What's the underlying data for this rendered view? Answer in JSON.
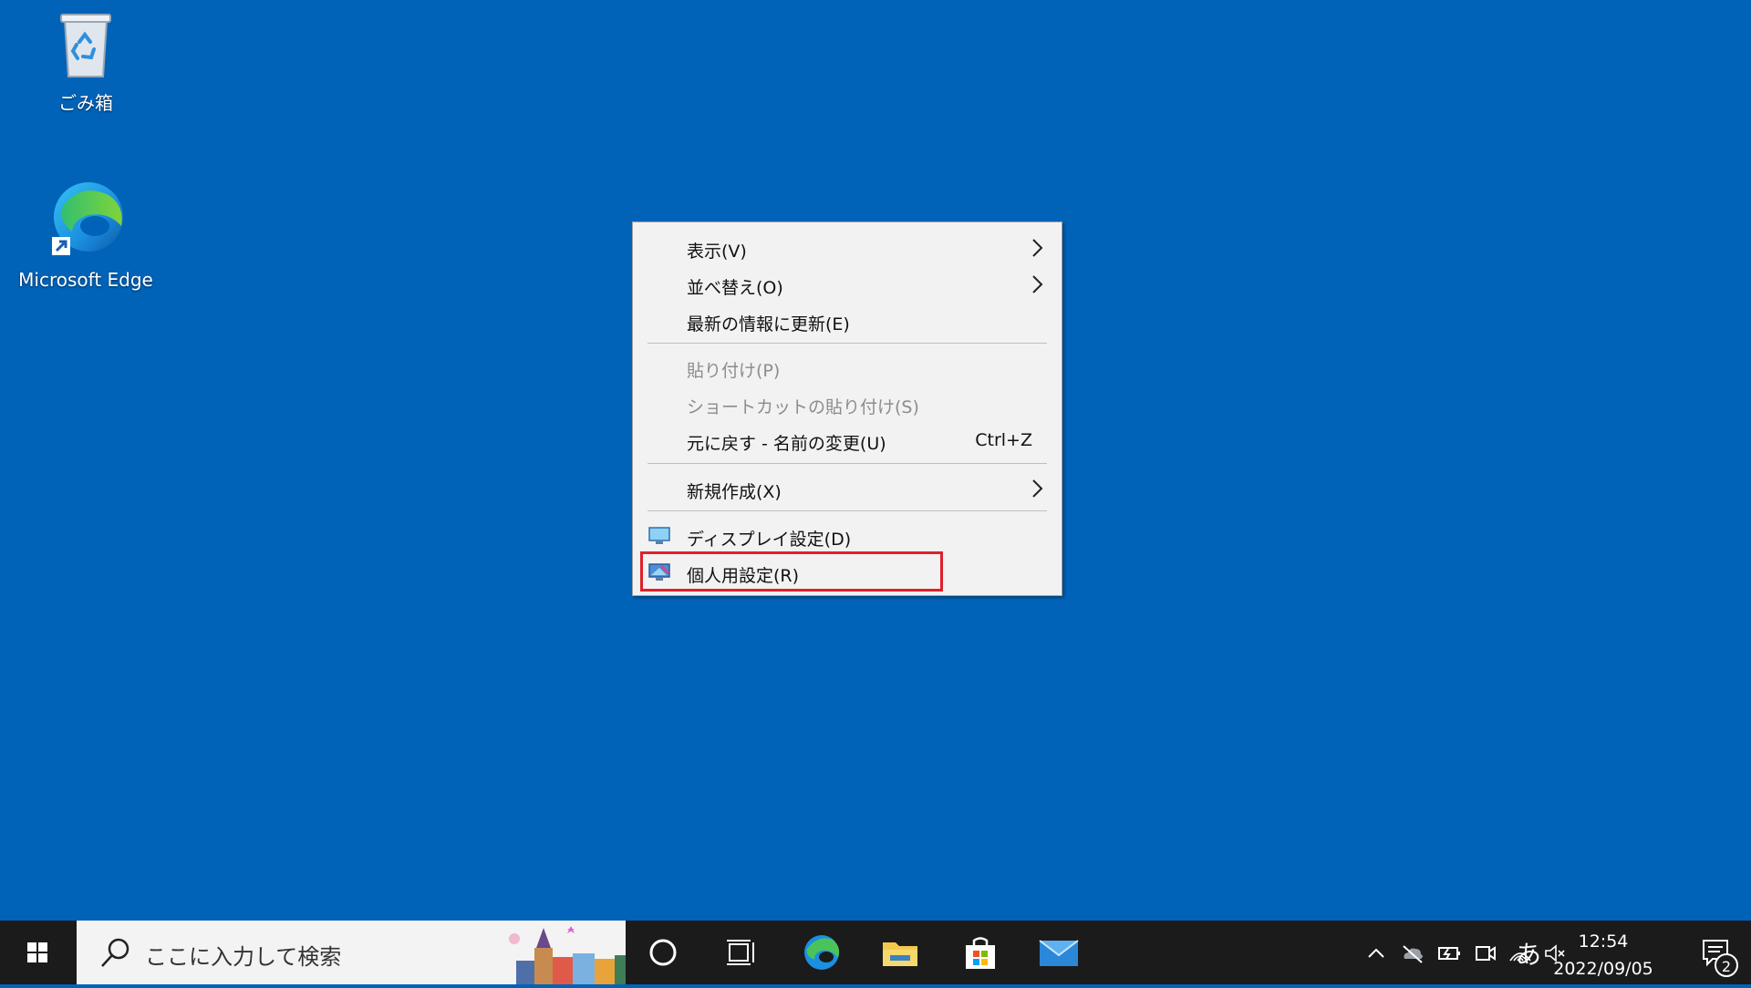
{
  "desktop": {
    "icons": [
      {
        "label": "ごみ箱"
      },
      {
        "label": "Microsoft Edge"
      }
    ]
  },
  "context_menu": {
    "items": [
      {
        "label": "表示(V)",
        "has_submenu": true,
        "enabled": true
      },
      {
        "label": "並べ替え(O)",
        "has_submenu": true,
        "enabled": true
      },
      {
        "label": "最新の情報に更新(E)",
        "enabled": true
      },
      {
        "label": "貼り付け(P)",
        "enabled": false
      },
      {
        "label": "ショートカットの貼り付け(S)",
        "enabled": false
      },
      {
        "label": "元に戻す - 名前の変更(U)",
        "shortcut": "Ctrl+Z",
        "enabled": true
      },
      {
        "label": "新規作成(X)",
        "has_submenu": true,
        "enabled": true
      },
      {
        "label": "ディスプレイ設定(D)",
        "icon": "display-settings-icon",
        "enabled": true
      },
      {
        "label": "個人用設定(R)",
        "icon": "personalize-icon",
        "enabled": true,
        "highlighted": true
      }
    ]
  },
  "taskbar": {
    "search_placeholder": "ここに入力して検索",
    "pinned": [
      "cortana-icon",
      "task-view-icon",
      "edge-icon",
      "file-explorer-icon",
      "microsoft-store-icon",
      "mail-icon"
    ],
    "ime_indicator": "あ",
    "time": "12:54",
    "date": "2022/09/05",
    "notification_count": "2"
  },
  "colors": {
    "desktop_bg": "#0063b8",
    "taskbar_bg": "#1b1b1b",
    "highlight_border": "#e0202a"
  }
}
